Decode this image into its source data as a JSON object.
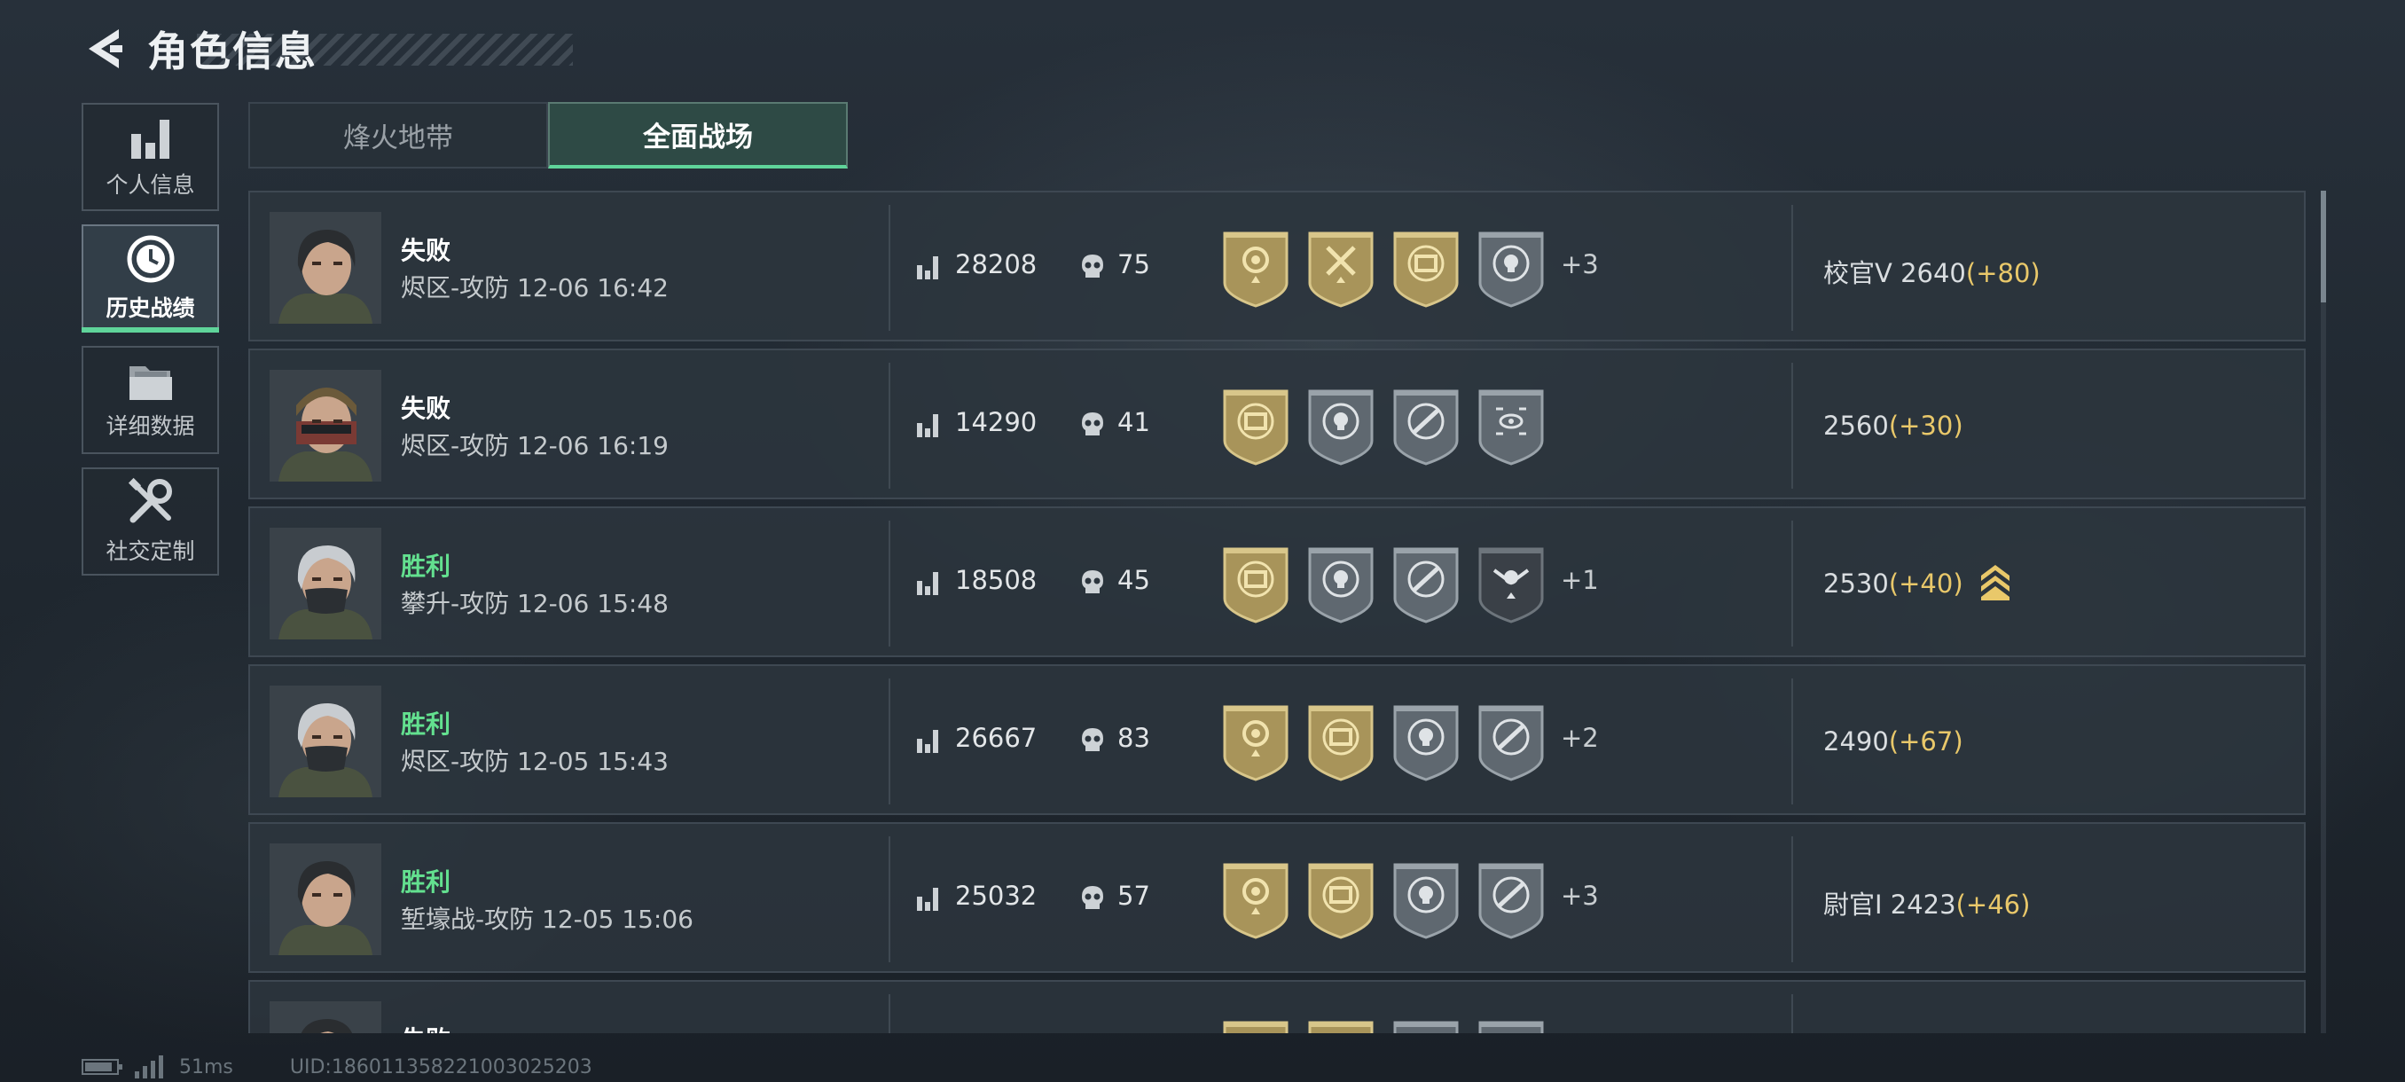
{
  "header": {
    "title": "角色信息",
    "back_icon": "back-arrow-icon"
  },
  "nav": [
    {
      "label": "个人信息",
      "icon": "bar-chart-icon",
      "active": false
    },
    {
      "label": "历史战绩",
      "icon": "clock-history-icon",
      "active": true
    },
    {
      "label": "详细数据",
      "icon": "folder-icon",
      "active": false
    },
    {
      "label": "社交定制",
      "icon": "tools-icon",
      "active": false
    }
  ],
  "tabs": [
    {
      "label": "烽火地带",
      "active": false
    },
    {
      "label": "全面战场",
      "active": true
    }
  ],
  "records": [
    {
      "result": "失败",
      "win": false,
      "mode": "烬区-攻防 12-06 16:42",
      "score": "28208",
      "kills": "75",
      "badges": [
        "gold-flower-badge",
        "gold-axes-badge",
        "gold-crate-badge",
        "gray-skull-target-badge"
      ],
      "extra": "+3",
      "rank_prefix": "校官V ",
      "rank_score": "2640",
      "rank_gain": "(+80)",
      "rank_up": false
    },
    {
      "result": "失败",
      "win": false,
      "mode": "烬区-攻防 12-06 16:19",
      "score": "14290",
      "kills": "41",
      "badges": [
        "gold-crate-badge",
        "gray-skull-target-badge",
        "gray-rifle-target-badge",
        "gray-eye-target-badge"
      ],
      "extra": "",
      "rank_prefix": "",
      "rank_score": "2560",
      "rank_gain": "(+30)",
      "rank_up": false
    },
    {
      "result": "胜利",
      "win": true,
      "mode": "攀升-攻防 12-06 15:48",
      "score": "18508",
      "kills": "45",
      "badges": [
        "gold-crate-badge",
        "gray-skull-target-badge",
        "gray-rifle-target-badge",
        "dark-skull-wings-badge"
      ],
      "extra": "+1",
      "rank_prefix": "",
      "rank_score": "2530",
      "rank_gain": "(+40)",
      "rank_up": true
    },
    {
      "result": "胜利",
      "win": true,
      "mode": "烬区-攻防 12-05 15:43",
      "score": "26667",
      "kills": "83",
      "badges": [
        "gold-flower-badge",
        "gold-crate-badge",
        "gray-skull-target-badge",
        "gray-rifle-target-badge"
      ],
      "extra": "+2",
      "rank_prefix": "",
      "rank_score": "2490",
      "rank_gain": "(+67)",
      "rank_up": false
    },
    {
      "result": "胜利",
      "win": true,
      "mode": "堑壕战-攻防 12-05 15:06",
      "score": "25032",
      "kills": "57",
      "badges": [
        "gold-flower-badge",
        "gold-crate-badge",
        "gray-skull-target-badge",
        "gray-rifle-target-badge"
      ],
      "extra": "+3",
      "rank_prefix": "尉官Ⅰ ",
      "rank_score": "2423",
      "rank_gain": "(+46)",
      "rank_up": false
    },
    {
      "result": "失败",
      "win": false,
      "mode": "",
      "score": "",
      "kills": "",
      "badges": [
        "gold-flower-badge",
        "gold-crate-badge",
        "gray-skull-target-badge",
        "gray-star-badge"
      ],
      "extra": "",
      "rank_prefix": "",
      "rank_score": "",
      "rank_gain": "",
      "rank_up": false
    }
  ],
  "footer": {
    "ping": "51ms",
    "uid": "UID:1860113582210030252​03"
  },
  "colors": {
    "win": "#63e08f",
    "accent": "#5fd49a",
    "gain": "#e9c86a",
    "gold": "#a8945a"
  }
}
